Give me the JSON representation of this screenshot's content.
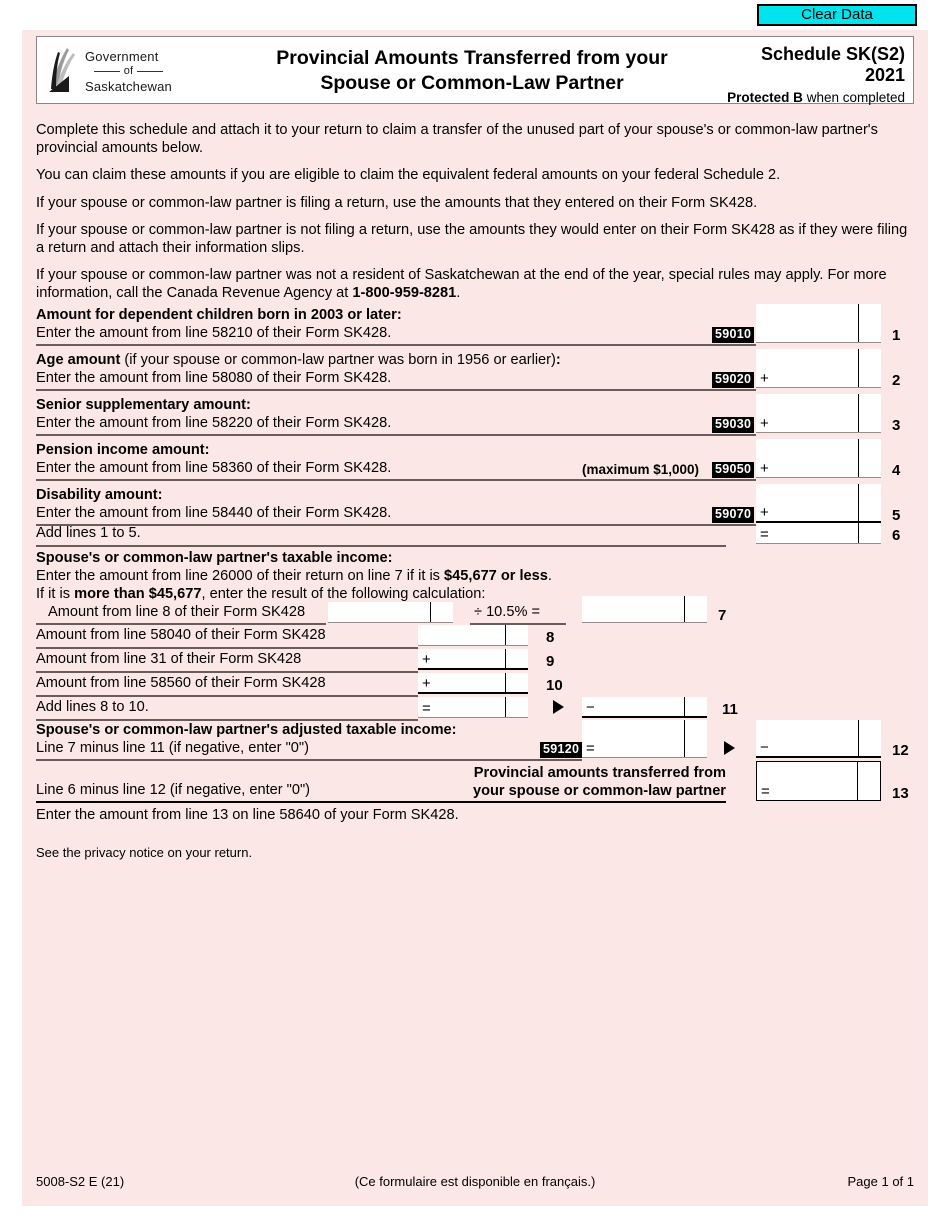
{
  "toolbar": {
    "clear_data_label": "Clear Data"
  },
  "header": {
    "logo_line1": "Government",
    "logo_line2": "of",
    "logo_line3": "Saskatchewan",
    "title_line1": "Provincial Amounts Transferred from your",
    "title_line2": "Spouse or Common-Law Partner",
    "schedule": "Schedule SK(S2)",
    "year": "2021",
    "protected_strong": "Protected B",
    "protected_rest": " when completed"
  },
  "intro": {
    "p1": "Complete this schedule and attach it to your return to claim a transfer of the unused part of your spouse's or common-law partner's provincial amounts below.",
    "p2": "You can claim these amounts if you are eligible to claim the equivalent federal amounts on your federal Schedule 2.",
    "p3": "If your spouse or common-law partner is filing a return, use the amounts that they entered on their Form SK428.",
    "p4": "If your spouse or common-law partner is not filing a return, use the amounts they would enter on their Form SK428 as if they were filing a return and attach their information slips.",
    "p5a": "If your spouse or common-law partner was not a resident of Saskatchewan at the end of the year, special rules may apply. For more information, call the Canada Revenue Agency at ",
    "p5b": "1-800-959-8281",
    "p5c": "."
  },
  "lines": {
    "l1": {
      "heading": "Amount for dependent children born in 2003 or later:",
      "sub": "Enter the amount from line 58210 of their Form SK428.",
      "code": "59010",
      "sign": "",
      "num": "1"
    },
    "l2": {
      "heading_bold": "Age amount",
      "heading_rest": " (if your spouse or common-law partner was born in 1956 or earlier)",
      "heading_colon": ":",
      "sub": "Enter the amount from line 58080 of their Form SK428.",
      "code": "59020",
      "sign": "+",
      "num": "2"
    },
    "l3": {
      "heading": "Senior supplementary amount:",
      "sub": "Enter the amount from line 58220 of their Form SK428.",
      "code": "59030",
      "sign": "+",
      "num": "3"
    },
    "l4": {
      "heading": "Pension income amount:",
      "sub": "Enter the amount from line 58360 of their Form SK428.",
      "maximum": "(maximum $1,000)",
      "code": "59050",
      "sign": "+",
      "num": "4"
    },
    "l5": {
      "heading": "Disability amount:",
      "sub": "Enter the amount from line 58440 of their Form SK428.",
      "code": "59070",
      "sign": "+",
      "num": "5"
    },
    "l6": {
      "label": "Add lines 1 to 5.",
      "sign": "=",
      "num": "6"
    },
    "l7": {
      "heading": "Spouse's or common-law partner's taxable income:",
      "sub1a": "Enter the amount from line 26000 of their return on line 7 if it is ",
      "sub1b": "$45,677 or less",
      "sub1c": ".",
      "sub2a": "If it is ",
      "sub2b": "more than $45,677",
      "sub2c": ", enter the result of the following calculation:",
      "calc_label": "Amount from line 8 of their Form SK428",
      "operator": "÷ 10.5% =",
      "num": "7"
    },
    "l8": {
      "label": "Amount from line 58040 of their Form SK428",
      "sign": "",
      "num": "8"
    },
    "l9": {
      "label": "Amount from line 31 of their Form SK428",
      "sign": "+",
      "num": "9"
    },
    "l10": {
      "label": "Amount from line 58560 of their Form SK428",
      "sign": "+",
      "num": "10"
    },
    "l11": {
      "label": "Add lines 8 to 10.",
      "sign": "=",
      "sign2": "−",
      "num": "11"
    },
    "l12": {
      "heading": "Spouse's or common-law partner's adjusted taxable income:",
      "sub": "Line 7 minus line 11 (if negative, enter \"0\")",
      "code": "59120",
      "sign": "=",
      "sign2": "−",
      "num": "12"
    },
    "l13": {
      "label": "Line 6 minus line 12 (if negative, enter \"0\")",
      "result_line1": "Provincial amounts transferred from",
      "result_line2": "your spouse or common-law partner",
      "sign": "=",
      "num": "13"
    }
  },
  "closing": {
    "enter_note": "Enter the amount from line 13 on line 58640 of your Form SK428.",
    "privacy": "See the privacy notice on your return."
  },
  "footer": {
    "left": "5008-S2 E (21)",
    "center": "(Ce formulaire est disponible en français.)",
    "right": "Page 1 of 1"
  },
  "colors": {
    "sheet_bg": "#fbe8e6",
    "accent_button": "#00e4ee",
    "code_chip_bg": "#000000",
    "rule": "#9a8c8a"
  }
}
